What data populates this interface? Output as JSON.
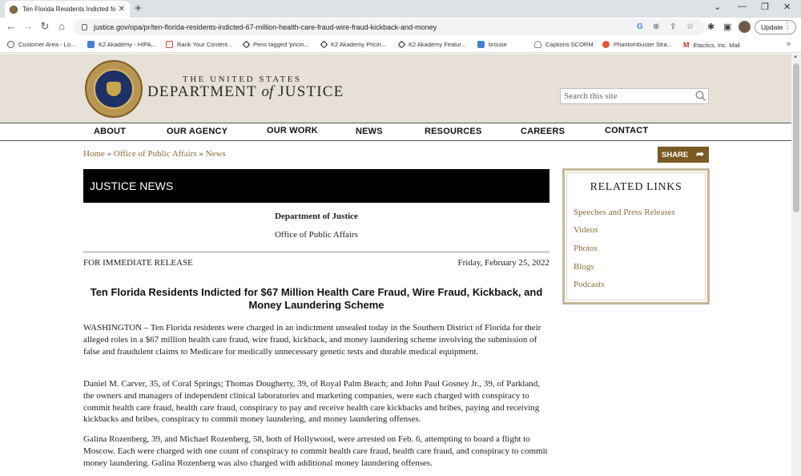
{
  "browser": {
    "tab_title": "Ten Florida Residents Indicted for $",
    "url": "justice.gov/opa/pr/ten-florida-residents-indicted-67-million-health-care-fraud-wire-fraud-kickback-and-money",
    "update_label": "Update",
    "bookmarks": [
      {
        "label": "Customer Area - Lo...",
        "icon": "globe-icon"
      },
      {
        "label": "K2 Akademy - HIPA...",
        "icon": "doc-icon"
      },
      {
        "label": "Rank Your Content...",
        "icon": "tab-icon"
      },
      {
        "label": "Pens tagged 'pricin...",
        "icon": "codepen-icon"
      },
      {
        "label": "K2 Akademy Pricin...",
        "icon": "codepen-icon"
      },
      {
        "label": "K2 Akademy Featur...",
        "icon": "codepen-icon"
      },
      {
        "label": "brouse",
        "icon": "doc-icon"
      },
      {
        "label": "Captions SCORM",
        "icon": "captions-icon"
      },
      {
        "label": "Phantombuster Stra...",
        "icon": "phantom-icon"
      },
      {
        "label": "Etactics, Inc. Mail",
        "icon": "gmail-icon"
      }
    ],
    "more_label": "»"
  },
  "site": {
    "logo_top": "THE UNITED STATES",
    "logo_dept": "DEPARTMENT",
    "logo_of": "of",
    "logo_justice": "JUSTICE",
    "search_placeholder": "Search this site",
    "nav": [
      "ABOUT",
      "OUR AGENCY",
      "OUR WORK",
      "NEWS",
      "RESOURCES",
      "CAREERS",
      "CONTACT"
    ],
    "breadcrumb": {
      "home": "Home",
      "sep": "»",
      "office": "Office of Public Affairs",
      "news": "News"
    },
    "share_label": "SHARE"
  },
  "article": {
    "banner": "JUSTICE NEWS",
    "dept": "Department of Justice",
    "office": "Office of Public Affairs",
    "release": "FOR IMMEDIATE RELEASE",
    "date": "Friday, February 25, 2022",
    "headline": "Ten Florida Residents Indicted for $67 Million Health Care Fraud, Wire Fraud, Kickback, and Money Laundering Scheme",
    "paragraphs": [
      "WASHINGTON – Ten Florida residents were charged in an indictment unsealed today in the Southern District of Florida for their alleged roles in a $67 million health care fraud, wire fraud, kickback, and money laundering scheme involving the submission of false and fraudulent claims to Medicare for medically unnecessary genetic tests and durable medical equipment.",
      "Daniel M. Carver, 35, of Coral Springs; Thomas Dougherty, 39, of Royal Palm Beach; and John Paul Gosney Jr., 39, of Parkland, the owners and managers of independent clinical laboratories and marketing companies, were each charged with conspiracy to commit health care fraud, health care fraud, conspiracy to pay and receive health care kickbacks and bribes, paying and receiving kickbacks and bribes, conspiracy to commit money laundering, and money laundering offenses.",
      "Galina Rozenberg, 39, and Michael Rozenberg, 58, both of Hollywood, were arrested on Feb. 6, attempting to board a flight to Moscow. Each were charged with one count of conspiracy to commit health care fraud, health care fraud, and conspiracy to commit money laundering. Galina Rozenberg was also charged with additional money laundering offenses."
    ]
  },
  "related": {
    "title": "RELATED LINKS",
    "links": [
      "Speeches and Press Releases",
      "Videos",
      "Photos",
      "Blogs",
      "Podcasts"
    ]
  },
  "colors": {
    "header_bg": "#e6e0d7",
    "link_gold": "#8a6d3b",
    "share_bg": "#7a5a22"
  }
}
